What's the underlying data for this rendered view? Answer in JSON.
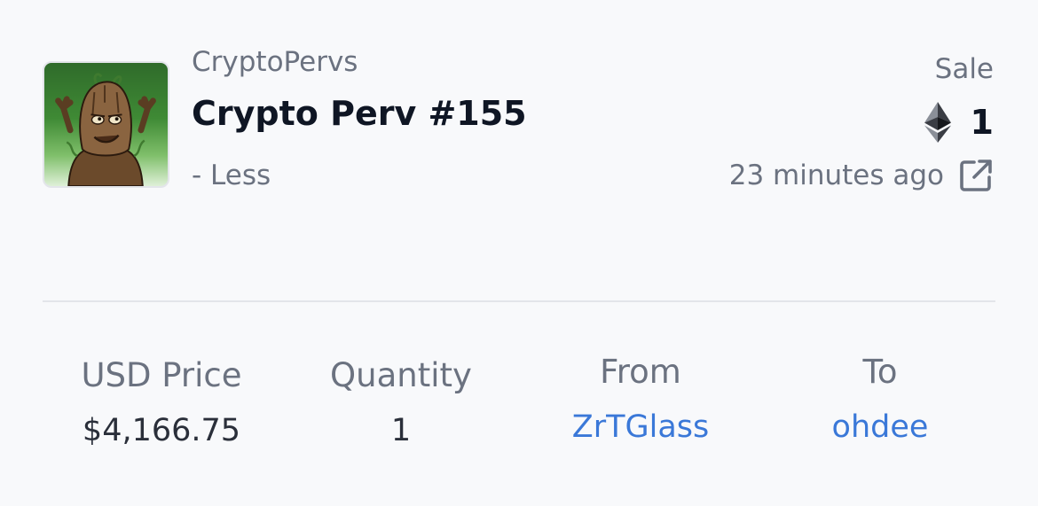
{
  "item": {
    "collection": "CryptoPervs",
    "name": "Crypto Perv #155",
    "toggle_label": "- Less",
    "thumbnail_icon": "nft-thumbnail-tree-character"
  },
  "event": {
    "type": "Sale",
    "amount": "1",
    "currency_icon": "ethereum-icon",
    "time_ago": "23 minutes ago",
    "link_icon": "external-link-icon"
  },
  "stats": {
    "usd_price": {
      "label": "USD Price",
      "value": "$4,166.75"
    },
    "quantity": {
      "label": "Quantity",
      "value": "1"
    },
    "from": {
      "label": "From",
      "value": "ZrTGlass"
    },
    "to": {
      "label": "To",
      "value": "ohdee"
    }
  },
  "colors": {
    "background": "#f8f9fb",
    "primary_text": "#0f1624",
    "muted_text": "#6b7280",
    "link": "#3a78d8",
    "divider": "#e3e5ea"
  }
}
